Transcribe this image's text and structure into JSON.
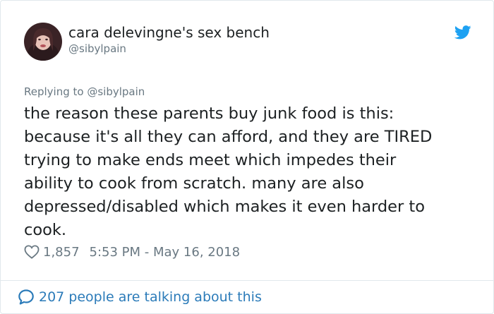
{
  "author": {
    "display_name": "cara delevingne's sex bench",
    "handle": "@sibylpain"
  },
  "reply": {
    "replying_to_label": "Replying to @sibylpain"
  },
  "tweet": {
    "text": "the reason these parents buy junk food is this:\nbecause it's all they can afford, and they are TIRED\ntrying to make ends meet which impedes their\nability to cook from scratch. many are also\ndepressed/disabled which makes it even harder to\ncook."
  },
  "meta": {
    "likes": "1,857",
    "timestamp": "5:53 PM - May 16, 2018"
  },
  "footer": {
    "talking_label": "207 people are talking about this"
  },
  "icons": {
    "bird": "twitter-bird-icon",
    "heart": "heart-icon",
    "bubble": "speech-bubble-icon"
  },
  "colors": {
    "twitter_blue": "#1da1f2",
    "link_blue": "#2b7bb9",
    "secondary_text": "#697882",
    "primary_text": "#1c2022"
  }
}
